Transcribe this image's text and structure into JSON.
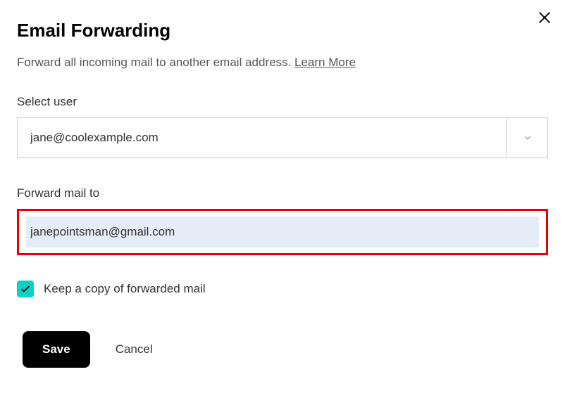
{
  "title": "Email Forwarding",
  "description": "Forward all incoming mail to another email address. ",
  "learn_more": "Learn More",
  "select_user": {
    "label": "Select user",
    "value": "jane@coolexample.com"
  },
  "forward_to": {
    "label": "Forward mail to",
    "value": "janepointsman@gmail.com"
  },
  "keep_copy": {
    "label": "Keep a copy of forwarded mail",
    "checked": true
  },
  "buttons": {
    "save": "Save",
    "cancel": "Cancel"
  }
}
